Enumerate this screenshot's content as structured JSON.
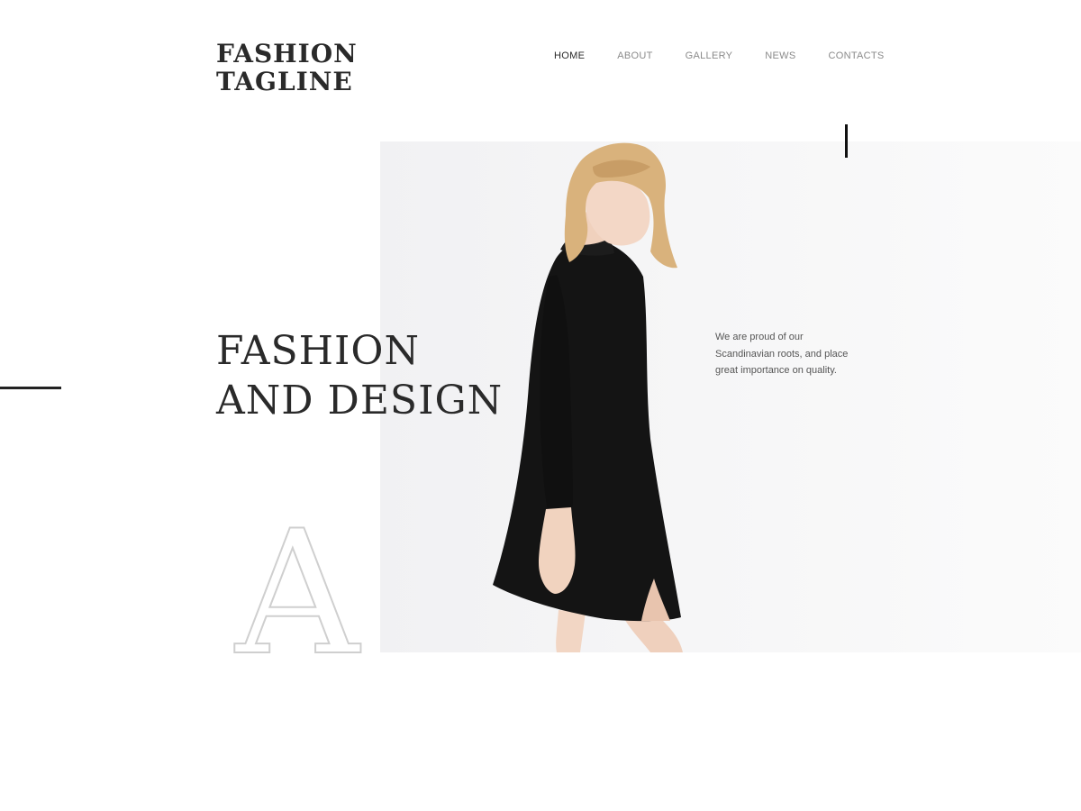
{
  "brand": {
    "line1": "FASHION",
    "line2": "TAGLINE"
  },
  "nav": {
    "items": [
      {
        "label": "HOME",
        "active": true
      },
      {
        "label": "ABOUT",
        "active": false
      },
      {
        "label": "GALLERY",
        "active": false
      },
      {
        "label": "NEWS",
        "active": false
      },
      {
        "label": "CONTACTS",
        "active": false
      }
    ]
  },
  "hero": {
    "headline_line1": "FASHION",
    "headline_line2": "AND DESIGN",
    "description": "We are proud of our Scandinavian roots, and place great importance on quality.",
    "decorative_letter": "A"
  },
  "colors": {
    "text_dark": "#2a2a2a",
    "nav_inactive": "#8a8a8a",
    "hero_bg": "#f3f3f5",
    "dress": "#131313",
    "deco_letter": "#cfcfcf"
  }
}
